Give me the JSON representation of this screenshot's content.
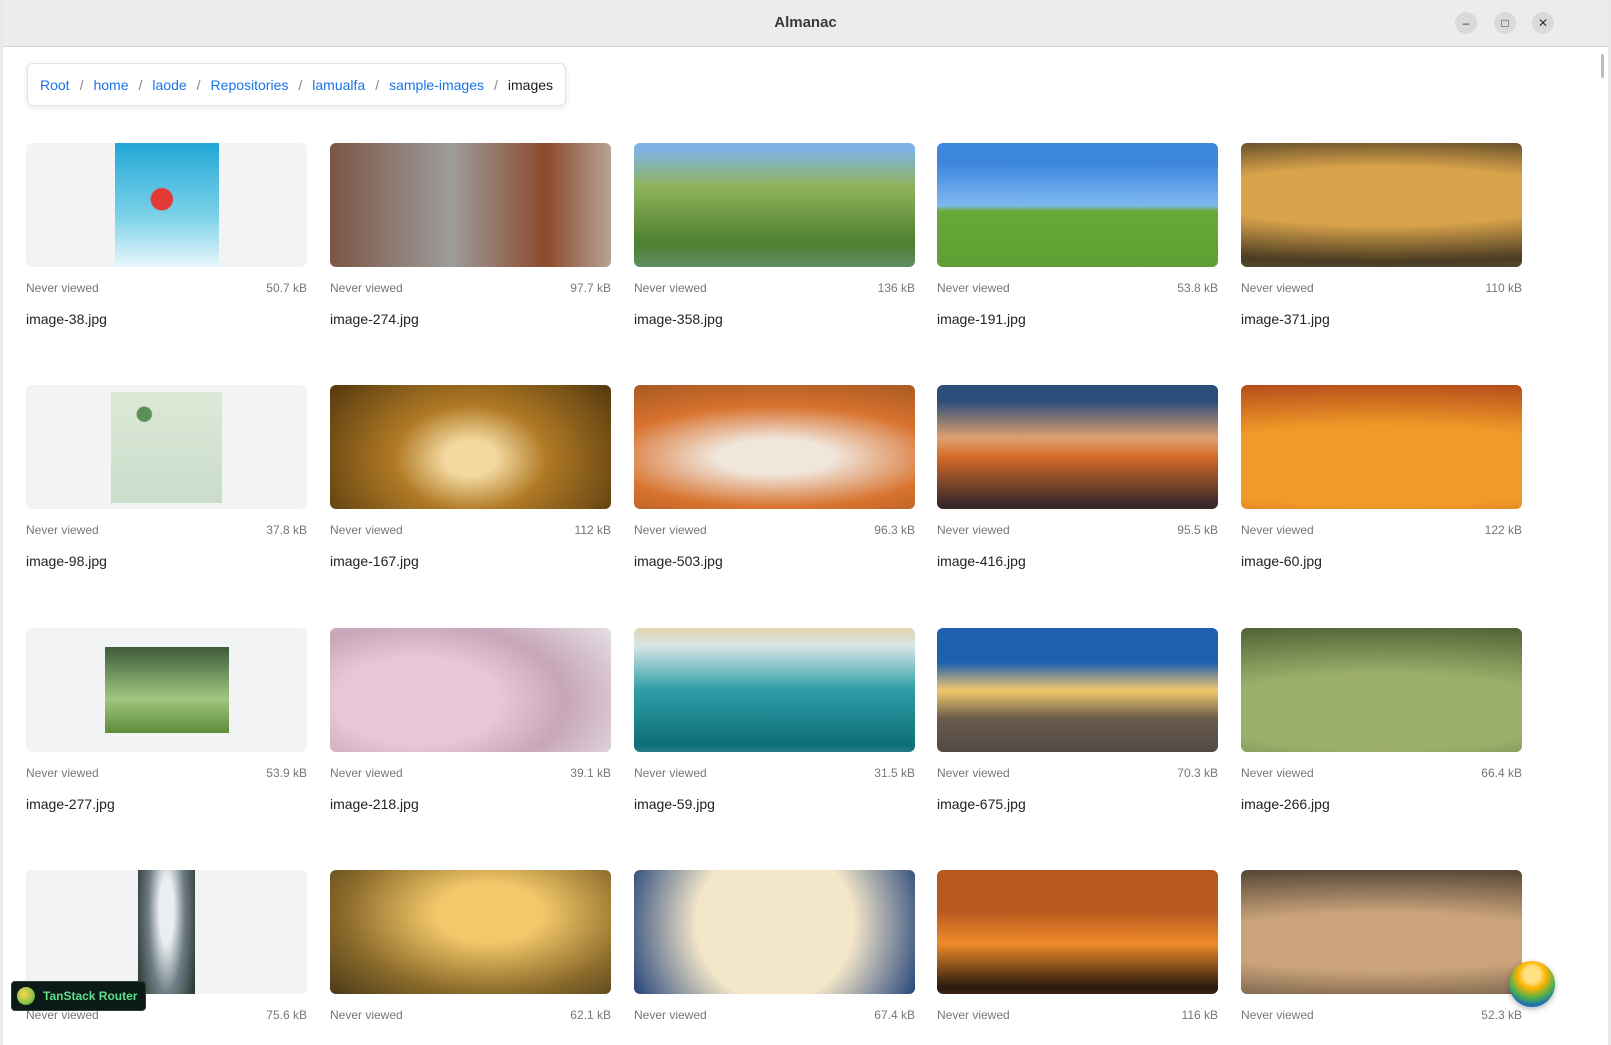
{
  "window": {
    "title": "Almanac",
    "controls": [
      "–",
      "□",
      "✕"
    ]
  },
  "breadcrumb": [
    "Root",
    "home",
    "laode",
    "Repositories",
    "lamualfa",
    "sample-images",
    "images"
  ],
  "files": [
    {
      "name": "image-38.jpg",
      "status": "Never viewed",
      "size": "50.7 kB"
    },
    {
      "name": "image-274.jpg",
      "status": "Never viewed",
      "size": "97.7 kB"
    },
    {
      "name": "image-358.jpg",
      "status": "Never viewed",
      "size": "136 kB"
    },
    {
      "name": "image-191.jpg",
      "status": "Never viewed",
      "size": "53.8 kB"
    },
    {
      "name": "image-371.jpg",
      "status": "Never viewed",
      "size": "110 kB"
    },
    {
      "name": "image-98.jpg",
      "status": "Never viewed",
      "size": "37.8 kB"
    },
    {
      "name": "image-167.jpg",
      "status": "Never viewed",
      "size": "112 kB"
    },
    {
      "name": "image-503.jpg",
      "status": "Never viewed",
      "size": "96.3 kB"
    },
    {
      "name": "image-416.jpg",
      "status": "Never viewed",
      "size": "95.5 kB"
    },
    {
      "name": "image-60.jpg",
      "status": "Never viewed",
      "size": "122 kB"
    },
    {
      "name": "image-277.jpg",
      "status": "Never viewed",
      "size": "53.9 kB"
    },
    {
      "name": "image-218.jpg",
      "status": "Never viewed",
      "size": "39.1 kB"
    },
    {
      "name": "image-59.jpg",
      "status": "Never viewed",
      "size": "31.5 kB"
    },
    {
      "name": "image-675.jpg",
      "status": "Never viewed",
      "size": "70.3 kB"
    },
    {
      "name": "image-266.jpg",
      "status": "Never viewed",
      "size": "66.4 kB"
    },
    {
      "name": "",
      "status": "Never viewed",
      "size": "75.6 kB"
    },
    {
      "name": "",
      "status": "Never viewed",
      "size": "62.1 kB"
    },
    {
      "name": "",
      "status": "Never viewed",
      "size": "67.4 kB"
    },
    {
      "name": "",
      "status": "Never viewed",
      "size": "116 kB"
    },
    {
      "name": "",
      "status": "Never viewed",
      "size": "52.3 kB"
    }
  ],
  "devtools": {
    "label": "TanStack Router"
  }
}
